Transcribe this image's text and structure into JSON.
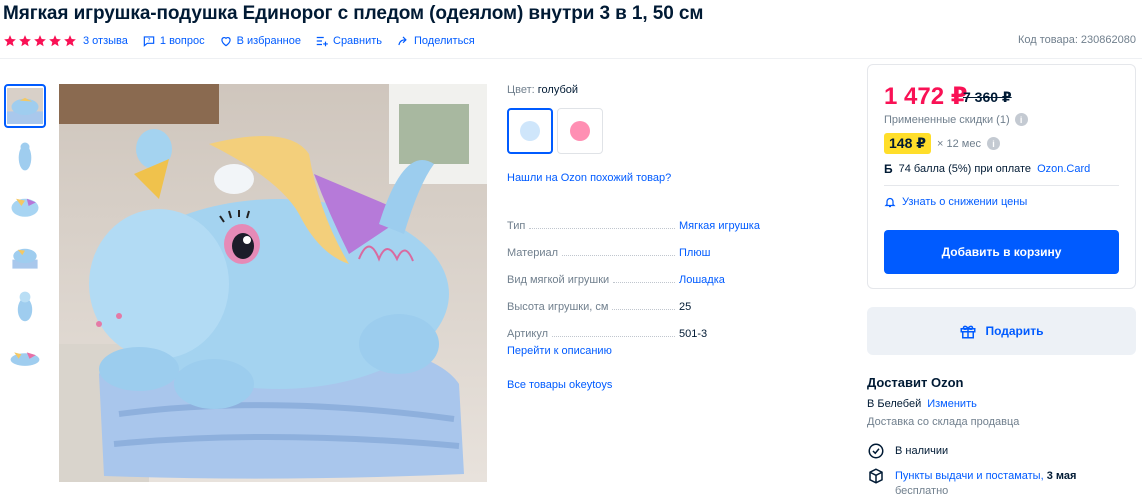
{
  "product": {
    "title": "Мягкая игрушка-подушка Единорог с пледом (одеялом) внутри 3 в 1, 50 см",
    "code": "Код товара: 230862080"
  },
  "meta": {
    "reviews": "3 отзыва",
    "questions": "1 вопрос",
    "favorite": "В избранное",
    "compare": "Сравнить",
    "share": "Поделиться",
    "star_color": "#f91155",
    "rating_stars": 5
  },
  "color": {
    "label": "Цвет:",
    "value": "голубой",
    "swatches": [
      "#cfe6fb",
      "#ff8fb3"
    ]
  },
  "similar_link": "Нашли на Ozon похожий товар?",
  "specs": [
    {
      "key": "Тип",
      "value": "Мягкая игрушка"
    },
    {
      "key": "Материал",
      "value": "Плюш"
    },
    {
      "key": "Вид мягкой игрушки",
      "value": "Лошадка"
    },
    {
      "key": "Высота игрушки, см",
      "value": "25"
    },
    {
      "key": "Артикул",
      "value": "501-3"
    }
  ],
  "goto_description": "Перейти к описанию",
  "all_goods": "Все товары okeytoys",
  "price_card": {
    "price": "1 472 ₽",
    "old_price": "7 360 ₽",
    "discounts": "Примененные скидки (1)",
    "installment_badge": "148 ₽",
    "installment_term": "× 12 мес",
    "points_icon": "Б",
    "points_text": "74 балла (5%) при оплате",
    "points_link": "Ozon.Card",
    "notify": "Узнать о снижении цены",
    "add_to_cart": "Добавить в корзину"
  },
  "gift": "Подарить",
  "delivery": {
    "heading": "Доставит Ozon",
    "city": "В Белебей",
    "change": "Изменить",
    "from": "Доставка со склада продавца",
    "in_stock": "В наличии",
    "pickup_link": "Пункты выдачи и постаматы,",
    "pickup_date": "3 мая",
    "pickup_price": "бесплатно"
  }
}
